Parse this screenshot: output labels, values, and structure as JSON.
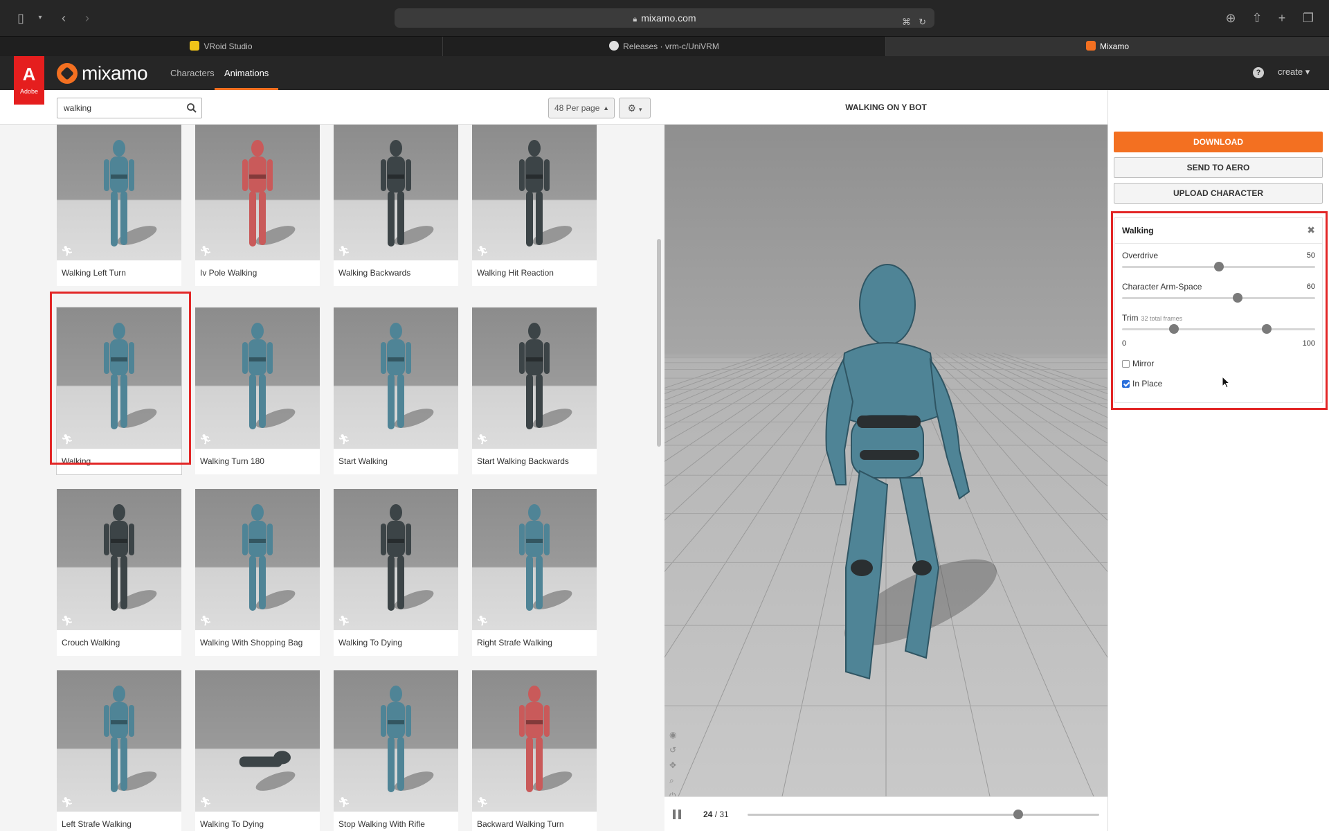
{
  "browser": {
    "url": "mixamo.com",
    "tabs": [
      {
        "label": "VRoid Studio",
        "active": false
      },
      {
        "label": "Releases · vrm-c/UniVRM",
        "active": false
      },
      {
        "label": "Mixamo",
        "active": true
      }
    ]
  },
  "header": {
    "adobe_label": "Adobe",
    "logo_text": "mixamo",
    "nav": [
      {
        "label": "Characters",
        "active": false
      },
      {
        "label": "Animations",
        "active": true
      }
    ],
    "help_icon": "help-icon",
    "create_label": "create"
  },
  "search": {
    "value": "walking",
    "placeholder": "Search"
  },
  "per_page": "48 Per page",
  "animations": [
    {
      "name": "Walking Left Turn",
      "figure": "ybot-blue"
    },
    {
      "name": "Iv Pole Walking",
      "figure": "xbot-red"
    },
    {
      "name": "Walking Backwards",
      "figure": "soldier"
    },
    {
      "name": "Walking Hit Reaction",
      "figure": "soldier"
    },
    {
      "name": "Walking",
      "figure": "ybot-blue",
      "selected": true
    },
    {
      "name": "Walking Turn 180",
      "figure": "ybot-blue"
    },
    {
      "name": "Start Walking",
      "figure": "ybot-blue"
    },
    {
      "name": "Start Walking Backwards",
      "figure": "soldier"
    },
    {
      "name": "Crouch Walking",
      "figure": "soldier"
    },
    {
      "name": "Walking With Shopping Bag",
      "figure": "ybot-blue"
    },
    {
      "name": "Walking To Dying",
      "figure": "soldier"
    },
    {
      "name": "Right Strafe Walking",
      "figure": "ybot-blue"
    },
    {
      "name": "Left Strafe Walking",
      "figure": "ybot-blue"
    },
    {
      "name": "Walking To Dying",
      "figure": "soldier-fallen"
    },
    {
      "name": "Stop Walking With Rifle",
      "figure": "ybot-blue"
    },
    {
      "name": "Backward Walking Turn",
      "figure": "xbot-red"
    }
  ],
  "viewer": {
    "title": "WALKING ON Y BOT",
    "frame_current": "24",
    "frame_total": "31",
    "progress": 0.77
  },
  "actions": {
    "download": "DOWNLOAD",
    "send": "SEND TO AERO",
    "upload": "UPLOAD CHARACTER"
  },
  "settings": {
    "title": "Walking",
    "overdrive": {
      "label": "Overdrive",
      "value": "50",
      "fraction": 0.5
    },
    "arm_space": {
      "label": "Character Arm-Space",
      "value": "60",
      "fraction": 0.6
    },
    "trim": {
      "label": "Trim",
      "note": "32 total frames",
      "min": "0",
      "max": "100",
      "start": 0.27,
      "end": 0.75
    },
    "mirror": {
      "label": "Mirror",
      "checked": false
    },
    "in_place": {
      "label": "In Place",
      "checked": true
    }
  },
  "colors": {
    "accent": "#f37021",
    "highlight": "#e22626",
    "ybot": "#4f8496",
    "xbot": "#c95a5a",
    "soldier": "#3c4447"
  }
}
